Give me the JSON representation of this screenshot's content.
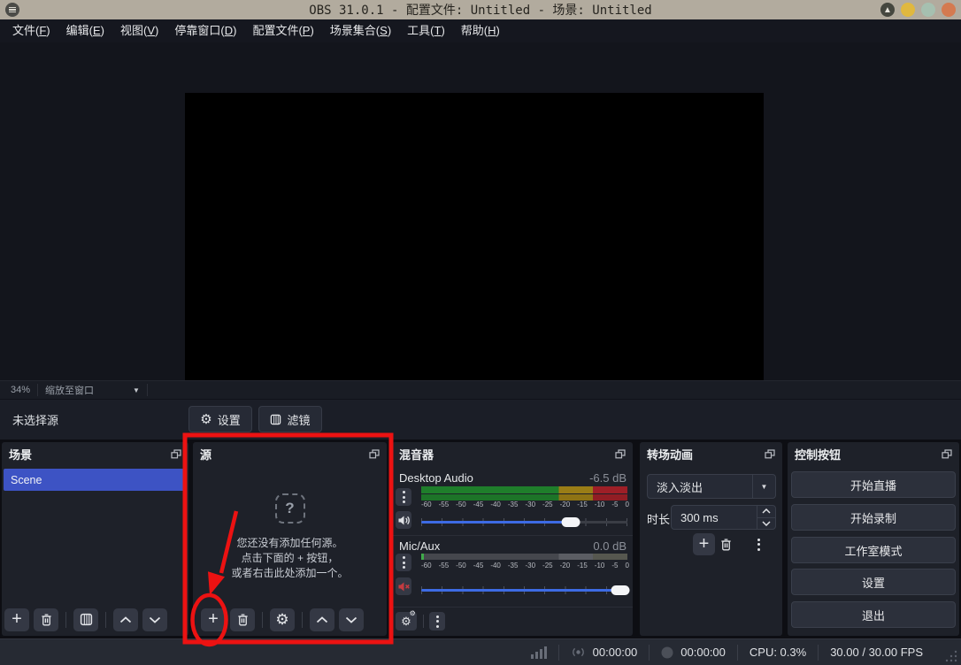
{
  "titlebar": {
    "title": "OBS 31.0.1 - 配置文件: Untitled - 场景: Untitled"
  },
  "menu": {
    "items": [
      "文件(F)",
      "编辑(E)",
      "视图(V)",
      "停靠窗口(D)",
      "配置文件(P)",
      "场景集合(S)",
      "工具(T)",
      "帮助(H)"
    ]
  },
  "preview": {
    "zoom_level": "34%",
    "scale_mode": "缩放至窗口"
  },
  "source_row": {
    "no_source": "未选择源",
    "settings": "设置",
    "filters": "滤镜"
  },
  "scenes": {
    "title": "场景",
    "items": [
      {
        "label": "Scene"
      }
    ]
  },
  "sources": {
    "title": "源",
    "placeholder_glyph": "?",
    "empty_line1": "您还没有添加任何源。",
    "empty_line2": "点击下面的 + 按钮，",
    "empty_line3": "或者右击此处添加一个。"
  },
  "mixer": {
    "title": "混音器",
    "desktop": {
      "name": "Desktop Audio",
      "level": "-6.5 dB",
      "slider_percent": 72.5
    },
    "mic": {
      "name": "Mic/Aux",
      "level": "0.0 dB",
      "muted": true,
      "slider_percent": 96.5
    },
    "ticks": [
      "-60",
      "-55",
      "-50",
      "-45",
      "-40",
      "-35",
      "-30",
      "-25",
      "-20",
      "-15",
      "-10",
      "-5",
      "0"
    ]
  },
  "transitions": {
    "title": "转场动画",
    "selected": "淡入淡出",
    "duration_label": "时长",
    "duration": "300 ms"
  },
  "controls": {
    "title": "控制按钮",
    "stream": "开始直播",
    "record": "开始录制",
    "studio": "工作室模式",
    "settings": "设置",
    "exit": "退出"
  },
  "statusbar": {
    "stream_time": "00:00:00",
    "record_time": "00:00:00",
    "cpu": "CPU: 0.3%",
    "fps": "30.00 / 30.00 FPS"
  },
  "colors": {
    "selection_blue": "#3d53c4",
    "slider_blue": "#3d6be4",
    "meter_green": "#1f7e2b",
    "meter_yellow": "#9a7d16",
    "meter_red": "#9e1f27",
    "annotation_red": "#ec1212",
    "titlebar_bg": "#b2ab9e"
  }
}
